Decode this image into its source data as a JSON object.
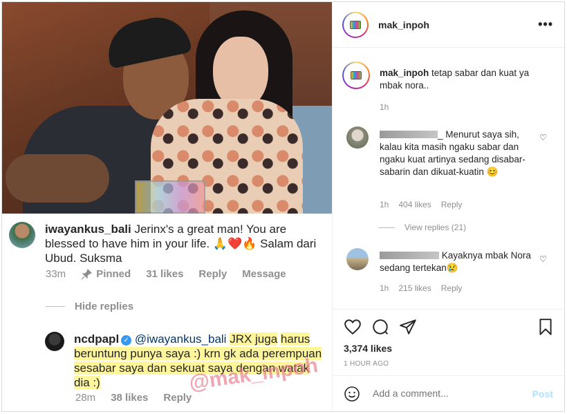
{
  "post": {
    "username": "mak_inpoh",
    "avatar_label": "mak_inpoh",
    "more_icon": "more-dots-icon",
    "caption": {
      "username": "mak_inpoh",
      "text": "tetap sabar dan kuat ya mbak nora..",
      "time": "1h"
    },
    "likes": "3,374 likes",
    "posted": "1 HOUR AGO",
    "add_comment_placeholder": "Add a comment...",
    "post_label": "Post"
  },
  "comments": [
    {
      "username_redacted": true,
      "username_suffix": "_",
      "text": "Menurut saya sih, kalau kita masih ngaku sabar dan ngaku kuat artinya sedang disabar- sabarin dan dikuat-kuatin 😊",
      "time": "1h",
      "likes": "404 likes",
      "reply": "Reply",
      "view_replies": "View replies (21)"
    },
    {
      "username_redacted": true,
      "text": "Kayaknya mbak Nora sedang tertekan😢",
      "time": "1h",
      "likes": "215 likes",
      "reply": "Reply"
    }
  ],
  "screenshot": {
    "comment": {
      "username": "iwayankus_bali",
      "text": "Jerinx's a great man! You are blessed to have him in your life. 🙏❤️🔥 Salam dari Ubud. Suksma",
      "time": "33m",
      "pinned": "Pinned",
      "likes": "31 likes",
      "reply": "Reply",
      "message": "Message"
    },
    "hide_replies": "Hide replies",
    "reply": {
      "username": "ncdpapl",
      "mention": "@iwayankus_bali",
      "text_line1": "JRX juga",
      "text_rest": "harus beruntung punya saya :) krn gk ada perempuan sesabar saya dan sekuat saya dengan watak dia :)",
      "time": "28m",
      "likes": "38 likes",
      "reply": "Reply"
    },
    "watermark": "@mak_inpoh"
  }
}
